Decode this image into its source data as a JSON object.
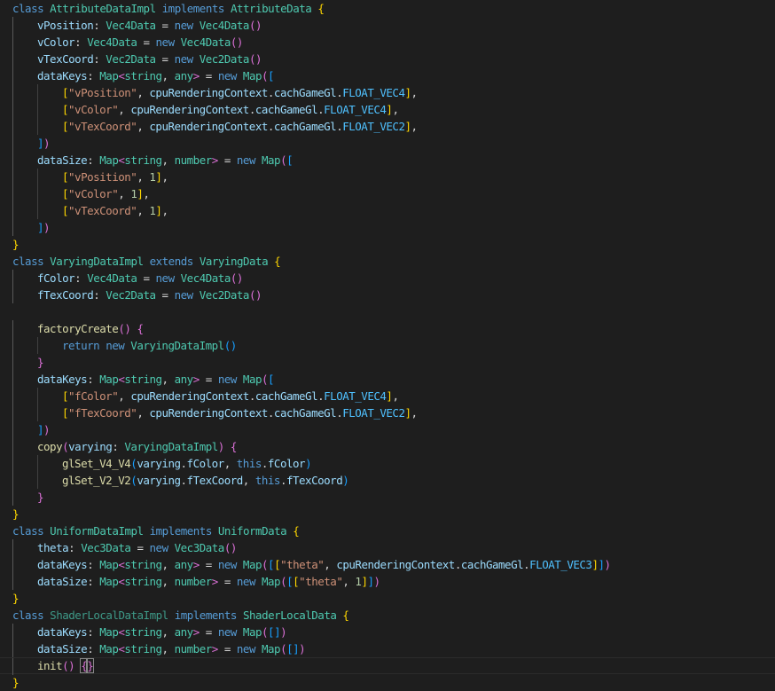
{
  "editor": {
    "language": "typescript",
    "current_line": 40,
    "lines": [
      "class AttributeDataImpl implements AttributeData {",
      "    vPosition: Vec4Data = new Vec4Data()",
      "    vColor: Vec4Data = new Vec4Data()",
      "    vTexCoord: Vec2Data = new Vec2Data()",
      "    dataKeys: Map<string, any> = new Map([",
      "        [\"vPosition\", cpuRenderingContext.cachGameGl.FLOAT_VEC4],",
      "        [\"vColor\", cpuRenderingContext.cachGameGl.FLOAT_VEC4],",
      "        [\"vTexCoord\", cpuRenderingContext.cachGameGl.FLOAT_VEC2],",
      "    ])",
      "    dataSize: Map<string, number> = new Map([",
      "        [\"vPosition\", 1],",
      "        [\"vColor\", 1],",
      "        [\"vTexCoord\", 1],",
      "    ])",
      "}",
      "class VaryingDataImpl extends VaryingData {",
      "    fColor: Vec4Data = new Vec4Data()",
      "    fTexCoord: Vec2Data = new Vec2Data()",
      "",
      "    factoryCreate() {",
      "        return new VaryingDataImpl()",
      "    }",
      "    dataKeys: Map<string, any> = new Map([",
      "        [\"fColor\", cpuRenderingContext.cachGameGl.FLOAT_VEC4],",
      "        [\"fTexCoord\", cpuRenderingContext.cachGameGl.FLOAT_VEC2],",
      "    ])",
      "    copy(varying: VaryingDataImpl) {",
      "        glSet_V4_V4(varying.fColor, this.fColor)",
      "        glSet_V2_V2(varying.fTexCoord, this.fTexCoord)",
      "    }",
      "}",
      "class UniformDataImpl implements UniformData {",
      "    theta: Vec3Data = new Vec3Data()",
      "    dataKeys: Map<string, any> = new Map([[\"theta\", cpuRenderingContext.cachGameGl.FLOAT_VEC3]])",
      "    dataSize: Map<string, number> = new Map([[\"theta\", 1]])",
      "}",
      "class ShaderLocalDataImpl implements ShaderLocalData {",
      "    dataKeys: Map<string, any> = new Map([])",
      "    dataSize: Map<string, number> = new Map([])",
      "    init() {}",
      "}"
    ]
  }
}
